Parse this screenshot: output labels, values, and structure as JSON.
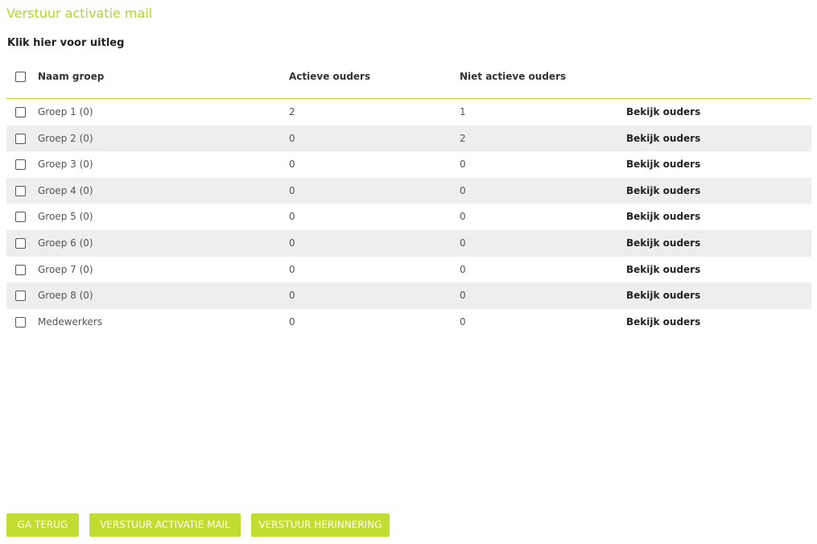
{
  "page": {
    "title": "Verstuur activatie mail",
    "help_link": "Klik hier voor uitleg"
  },
  "table": {
    "headers": {
      "name": "Naam groep",
      "active": "Actieve ouders",
      "inactive": "Niet actieve ouders"
    },
    "rows": [
      {
        "name": "Groep 1 (0)",
        "active": "2",
        "inactive": "1",
        "action": "Bekijk ouders"
      },
      {
        "name": "Groep 2 (0)",
        "active": "0",
        "inactive": "2",
        "action": "Bekijk ouders"
      },
      {
        "name": "Groep 3 (0)",
        "active": "0",
        "inactive": "0",
        "action": "Bekijk ouders"
      },
      {
        "name": "Groep 4 (0)",
        "active": "0",
        "inactive": "0",
        "action": "Bekijk ouders"
      },
      {
        "name": "Groep 5 (0)",
        "active": "0",
        "inactive": "0",
        "action": "Bekijk ouders"
      },
      {
        "name": "Groep 6 (0)",
        "active": "0",
        "inactive": "0",
        "action": "Bekijk ouders"
      },
      {
        "name": "Groep 7 (0)",
        "active": "0",
        "inactive": "0",
        "action": "Bekijk ouders"
      },
      {
        "name": "Groep 8 (0)",
        "active": "0",
        "inactive": "0",
        "action": "Bekijk ouders"
      },
      {
        "name": "Medewerkers",
        "active": "0",
        "inactive": "0",
        "action": "Bekijk ouders"
      }
    ]
  },
  "buttons": {
    "back": "GA TERUG",
    "send_activation": "VERSTUUR ACTIVATIE MAIL",
    "send_reminder": "VERSTUUR HERINNERING"
  },
  "colors": {
    "accent": "#b7d22a",
    "button_bg": "#c3dc32",
    "row_alt": "#eeeeee"
  }
}
